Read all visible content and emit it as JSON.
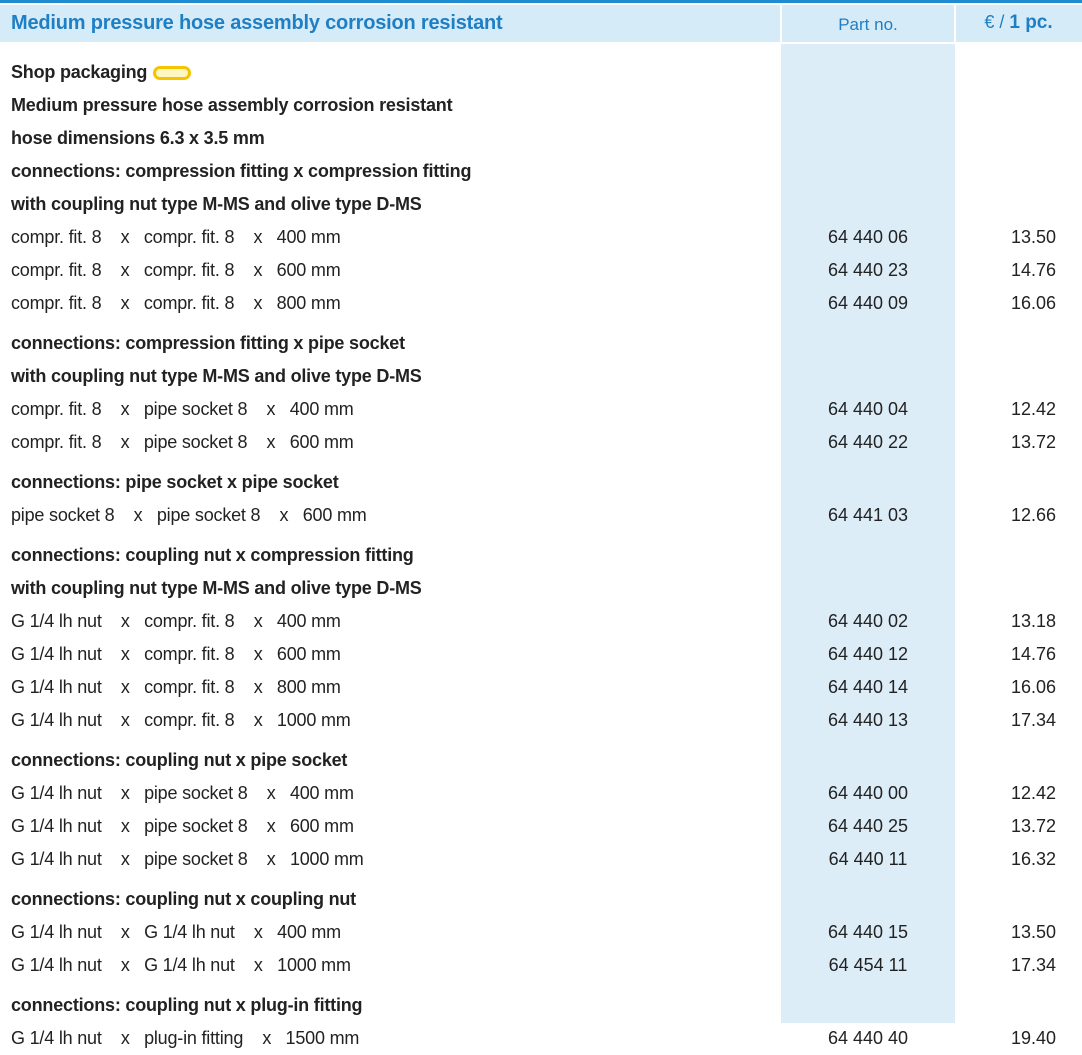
{
  "header": {
    "title": "Medium pressure hose assembly corrosion resistant",
    "part_no_label": "Part no.",
    "price_prefix": "€ / ",
    "price_unit": "1 pc."
  },
  "intro": {
    "shop_packaging": "Shop packaging",
    "icon": "packaging-icon",
    "lines": [
      "Medium pressure hose assembly corrosion resistant",
      "hose dimensions 6.3 x 3.5 mm"
    ]
  },
  "sections": [
    {
      "headings": [
        "connections: compression fitting x compression fitting",
        "with coupling nut type M-MS and olive type D-MS"
      ],
      "rows": [
        {
          "desc": "compr. fit. 8    x   compr. fit. 8    x   400 mm",
          "part": "64 440 06",
          "price": "13.50"
        },
        {
          "desc": "compr. fit. 8    x   compr. fit. 8    x   600 mm",
          "part": "64 440 23",
          "price": "14.76"
        },
        {
          "desc": "compr. fit. 8    x   compr. fit. 8    x   800 mm",
          "part": "64 440 09",
          "price": "16.06"
        }
      ]
    },
    {
      "headings": [
        "connections: compression fitting x pipe socket",
        "with coupling nut type M-MS and olive type D-MS"
      ],
      "rows": [
        {
          "desc": "compr. fit. 8    x   pipe socket 8    x   400 mm",
          "part": "64 440 04",
          "price": "12.42"
        },
        {
          "desc": "compr. fit. 8    x   pipe socket 8    x   600 mm",
          "part": "64 440 22",
          "price": "13.72"
        }
      ]
    },
    {
      "headings": [
        "connections: pipe socket x pipe socket"
      ],
      "rows": [
        {
          "desc": "pipe socket 8    x   pipe socket 8    x   600 mm",
          "part": "64 441 03",
          "price": "12.66"
        }
      ]
    },
    {
      "headings": [
        "connections: coupling nut x compression fitting",
        "with coupling nut type M-MS and olive type D-MS"
      ],
      "rows": [
        {
          "desc": "G 1/4 lh nut    x   compr. fit. 8    x   400 mm",
          "part": "64 440 02",
          "price": "13.18"
        },
        {
          "desc": "G 1/4 lh nut    x   compr. fit. 8    x   600 mm",
          "part": "64 440 12",
          "price": "14.76"
        },
        {
          "desc": "G 1/4 lh nut    x   compr. fit. 8    x   800 mm",
          "part": "64 440 14",
          "price": "16.06"
        },
        {
          "desc": "G 1/4 lh nut    x   compr. fit. 8    x   1000 mm",
          "part": "64 440 13",
          "price": "17.34"
        }
      ]
    },
    {
      "headings": [
        "connections: coupling nut x pipe socket"
      ],
      "rows": [
        {
          "desc": "G 1/4 lh nut    x   pipe socket 8    x   400 mm",
          "part": "64 440 00",
          "price": "12.42"
        },
        {
          "desc": "G 1/4 lh nut    x   pipe socket 8    x   600 mm",
          "part": "64 440 25",
          "price": "13.72"
        },
        {
          "desc": "G 1/4 lh nut    x   pipe socket 8    x   1000 mm",
          "part": "64 440 11",
          "price": "16.32"
        }
      ]
    },
    {
      "headings": [
        "connections: coupling nut x coupling nut"
      ],
      "rows": [
        {
          "desc": "G 1/4 lh nut    x   G 1/4 lh nut    x   400 mm",
          "part": "64 440 15",
          "price": "13.50"
        },
        {
          "desc": "G 1/4 lh nut    x   G 1/4 lh nut    x   1000 mm",
          "part": "64 454 11",
          "price": "17.34"
        }
      ]
    },
    {
      "headings": [
        "connections: coupling nut x plug-in fitting"
      ],
      "rows": [
        {
          "desc": "G 1/4 lh nut    x   plug-in fitting    x   1500 mm",
          "part": "64 440 40",
          "price": "19.40"
        }
      ]
    }
  ],
  "colors": {
    "accent": "#1f7fc4",
    "header_bg": "#d6ebf8",
    "column_band": "#dcedf8",
    "packaging_icon": "#f5c400"
  }
}
